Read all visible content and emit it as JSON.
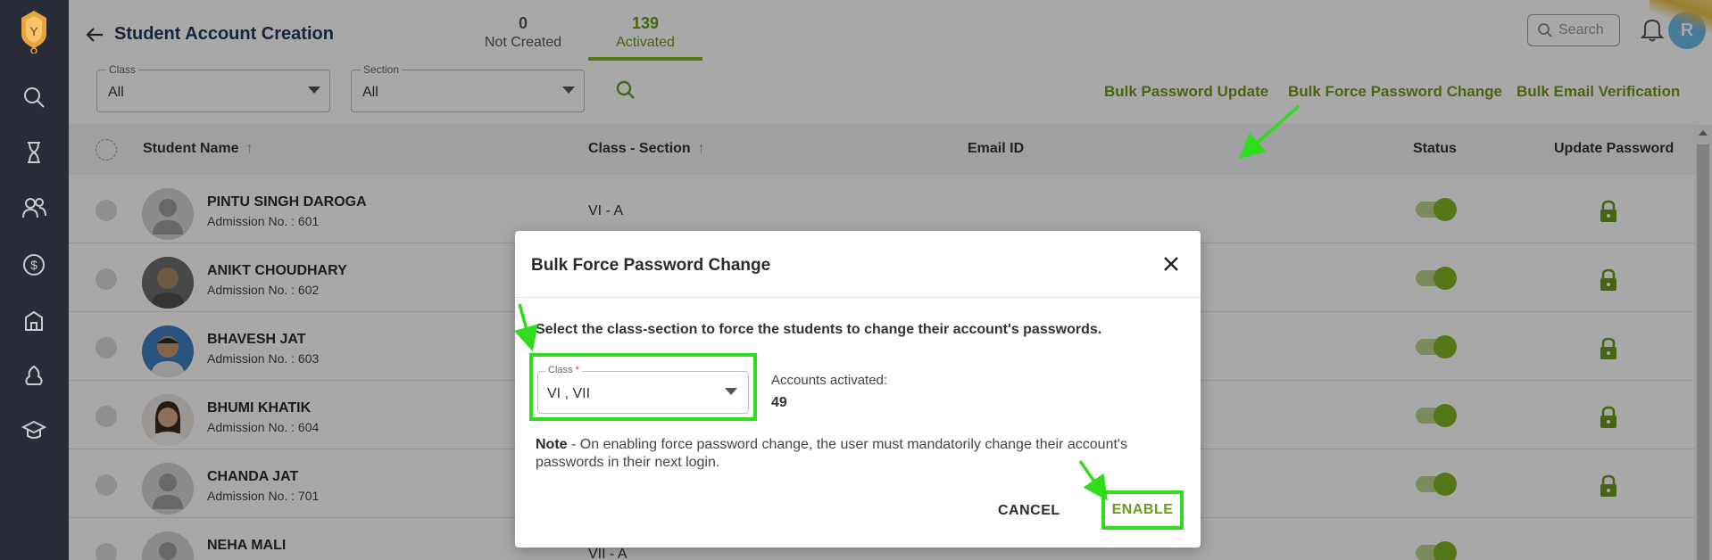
{
  "header": {
    "title": "Student Account Creation",
    "tabs": [
      {
        "count": "0",
        "label": "Not Created"
      },
      {
        "count": "139",
        "label": "Activated"
      }
    ],
    "search_placeholder": "Search",
    "avatar_initial": "R"
  },
  "filters": {
    "class_label": "Class",
    "class_value": "All",
    "section_label": "Section",
    "section_value": "All"
  },
  "bulk_actions": {
    "password_update": "Bulk Password Update",
    "force_password_change": "Bulk Force Password Change",
    "email_verification": "Bulk Email Verification"
  },
  "table": {
    "columns": {
      "student_name": "Student Name",
      "class_section": "Class - Section",
      "email_id": "Email ID",
      "status": "Status",
      "update_password": "Update Password"
    },
    "rows": [
      {
        "name": "PINTU SINGH DAROGA",
        "admission": "Admission No. : 601",
        "class_section": "VI - A",
        "status_on": true
      },
      {
        "name": "ANIKT CHOUDHARY",
        "admission": "Admission No. : 602",
        "class_section": "",
        "status_on": true
      },
      {
        "name": "BHAVESH JAT",
        "admission": "Admission No. : 603",
        "class_section": "",
        "status_on": true
      },
      {
        "name": "BHUMI KHATIK",
        "admission": "Admission No. : 604",
        "class_section": "",
        "status_on": true
      },
      {
        "name": "CHANDA JAT",
        "admission": "Admission No. : 701",
        "class_section": "",
        "status_on": true
      },
      {
        "name": "NEHA MALI",
        "admission": "",
        "class_section": "VII - A",
        "status_on": true
      }
    ]
  },
  "modal": {
    "title": "Bulk Force Password Change",
    "description": "Select the class-section to force the students to change their account's passwords.",
    "class_label": "Class",
    "class_required": "*",
    "class_value": "VI , VII",
    "accounts_label": "Accounts activated:",
    "accounts_value": "49",
    "note_prefix": "Note",
    "note_text": " - On enabling force password change, the user must mandatorily change their account's passwords in their next login.",
    "cancel_label": "CANCEL",
    "enable_label": "ENABLE"
  },
  "colors": {
    "accent": "#6b9a1d",
    "highlight": "#2fdc1e",
    "sidebar": "#272c36",
    "title": "#1f3a5f"
  }
}
